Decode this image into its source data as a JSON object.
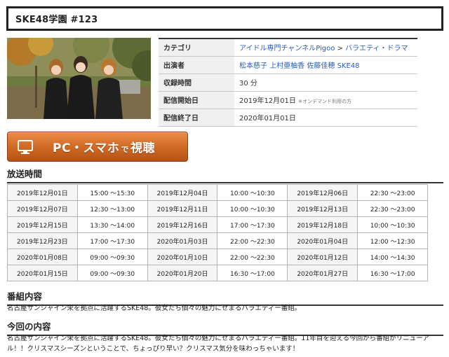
{
  "program_title": "SKE48学園 #123",
  "info": [
    {
      "key": "カテゴリ",
      "links": [
        "アイドル専門チャンネルPigoo",
        "バラエティ・ドラマ"
      ],
      "separator": " > "
    },
    {
      "key": "出演者",
      "links": [
        "松本慈子",
        "上村亜柚香",
        "佐藤佳穂",
        "SKE48"
      ]
    },
    {
      "key": "収録時間",
      "value": "30 分"
    },
    {
      "key": "配信開始日",
      "value": "2019年12月01日",
      "note": "※オンデマンド利用の方"
    },
    {
      "key": "配信終了日",
      "value": "2020年01月01日"
    }
  ],
  "watch_button": {
    "main": "PC・スマホ",
    "small": "で",
    "end": "視聴",
    "icon": "monitor-icon",
    "color": "#d06a25"
  },
  "broadcast_heading": "放送時間",
  "schedule": [
    [
      "2019年12月01日",
      "15:00 〜15:30",
      "2019年12月04日",
      "10:00 〜10:30",
      "2019年12月06日",
      "22:30 〜23:00"
    ],
    [
      "2019年12月07日",
      "12:30 〜13:00",
      "2019年12月11日",
      "10:00 〜10:30",
      "2019年12月13日",
      "22:30 〜23:00"
    ],
    [
      "2019年12月15日",
      "13:30 〜14:00",
      "2019年12月16日",
      "17:00 〜17:30",
      "2019年12月18日",
      "10:00 〜10:30"
    ],
    [
      "2019年12月23日",
      "17:00 〜17:30",
      "2020年01月03日",
      "22:00 〜22:30",
      "2020年01月04日",
      "12:00 〜12:30"
    ],
    [
      "2020年01月08日",
      "09:00 〜09:30",
      "2020年01月10日",
      "22:00 〜22:30",
      "2020年01月12日",
      "14:00 〜14:30"
    ],
    [
      "2020年01月15日",
      "09:00 〜09:30",
      "2020年01月20日",
      "16:30 〜17:00",
      "2020年01月27日",
      "16:30 〜17:00"
    ]
  ],
  "program_content": {
    "heading": "番組内容",
    "text": "名古屋サンシャイン栄を拠点に活躍するSKE48。彼女たち個々の魅力にせまるバラエティー番組。"
  },
  "episode_content": {
    "heading": "今回の内容",
    "text": "名古屋サンシャイン栄を拠点に活躍するSKE48。彼女たち個々の魅力にせまるバラエティー番組。11年目を迎える今回から番組がリニューアル！！クリスマスシーズンということで、ちょっぴり早い？クリスマス気分を味わっちゃいます！"
  }
}
